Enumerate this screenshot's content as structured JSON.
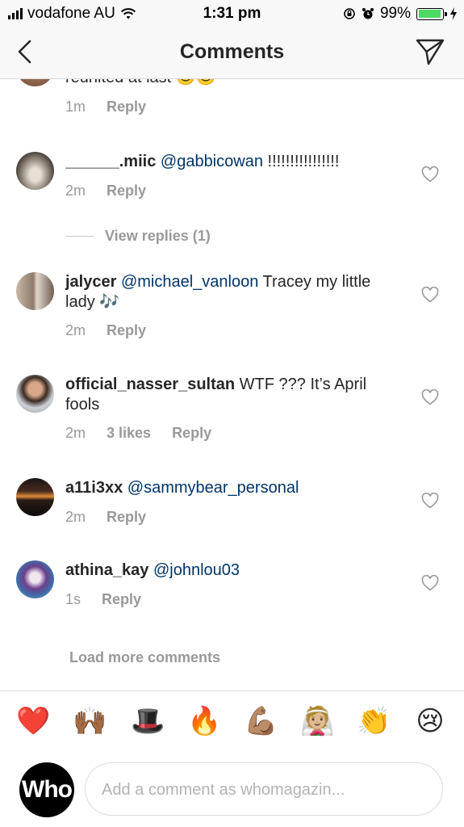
{
  "status_bar": {
    "carrier": "vodafone AU",
    "time": "1:31 pm",
    "battery": "99%"
  },
  "nav": {
    "title": "Comments"
  },
  "partial_comment": {
    "text": "reunited at last 😊😊",
    "time": "1m",
    "reply": "Reply"
  },
  "comments": [
    {
      "username": "______.miic",
      "mention": "@gabbicowan",
      "text": " !!!!!!!!!!!!!!!!",
      "time": "2m",
      "likes": "",
      "reply": "Reply"
    },
    {
      "username": "jalycer",
      "mention": "@michael_vanloon",
      "text": " Tracey my little lady 🎶",
      "time": "2m",
      "likes": "",
      "reply": "Reply"
    },
    {
      "username": "official_nasser_sultan",
      "mention": "",
      "text": " WTF ??? It’s April fools",
      "time": "2m",
      "likes": "3 likes",
      "reply": "Reply"
    },
    {
      "username": "a11i3xx",
      "mention": "@sammybear_personal",
      "text": "",
      "time": "2m",
      "likes": "",
      "reply": "Reply"
    },
    {
      "username": "athina_kay",
      "mention": "@johnlou03",
      "text": "",
      "time": "1s",
      "likes": "",
      "reply": "Reply"
    }
  ],
  "view_replies": "View replies (1)",
  "load_more": "Load more comments",
  "quick_emojis": [
    "❤️",
    "🙌🏾",
    "🎩",
    "🔥",
    "💪🏽",
    "👰🏼",
    "👏",
    "😢"
  ],
  "composer": {
    "avatar_text": "Who",
    "placeholder": "Add a comment as whomagazin..."
  },
  "icons": {
    "back": "chevron-left-icon",
    "send": "paper-plane-icon",
    "like": "heart-outline-icon"
  },
  "colors": {
    "mention": "#003569",
    "meta_gray": "#999999",
    "battery_green": "#4cd964"
  }
}
